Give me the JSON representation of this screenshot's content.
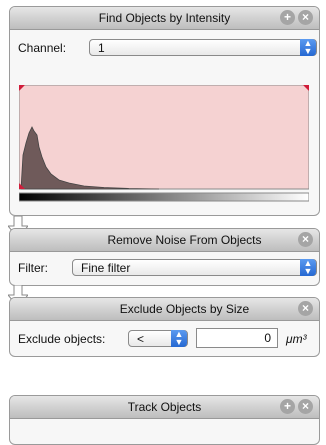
{
  "panels": {
    "find_objects": {
      "title": "Find Objects by Intensity",
      "channel_label": "Channel:",
      "channel_value": "1"
    },
    "remove_noise": {
      "title": "Remove Noise From Objects",
      "filter_label": "Filter:",
      "filter_value": "Fine filter"
    },
    "exclude_size": {
      "title": "Exclude Objects by Size",
      "exclude_label": "Exclude objects:",
      "operator_value": "<",
      "size_value": "0",
      "unit": "μm³"
    },
    "track_objects": {
      "title": "Track Objects"
    }
  },
  "icons": {
    "add": "plus-circle-icon",
    "close": "close-circle-icon",
    "flow": "flow-arrow-icon"
  },
  "colors": {
    "histogram_bg": "#f5d2d2",
    "histogram_fill": "#6f5a5a",
    "marker": "#d01c3a",
    "stepper": "#2f74dc"
  }
}
